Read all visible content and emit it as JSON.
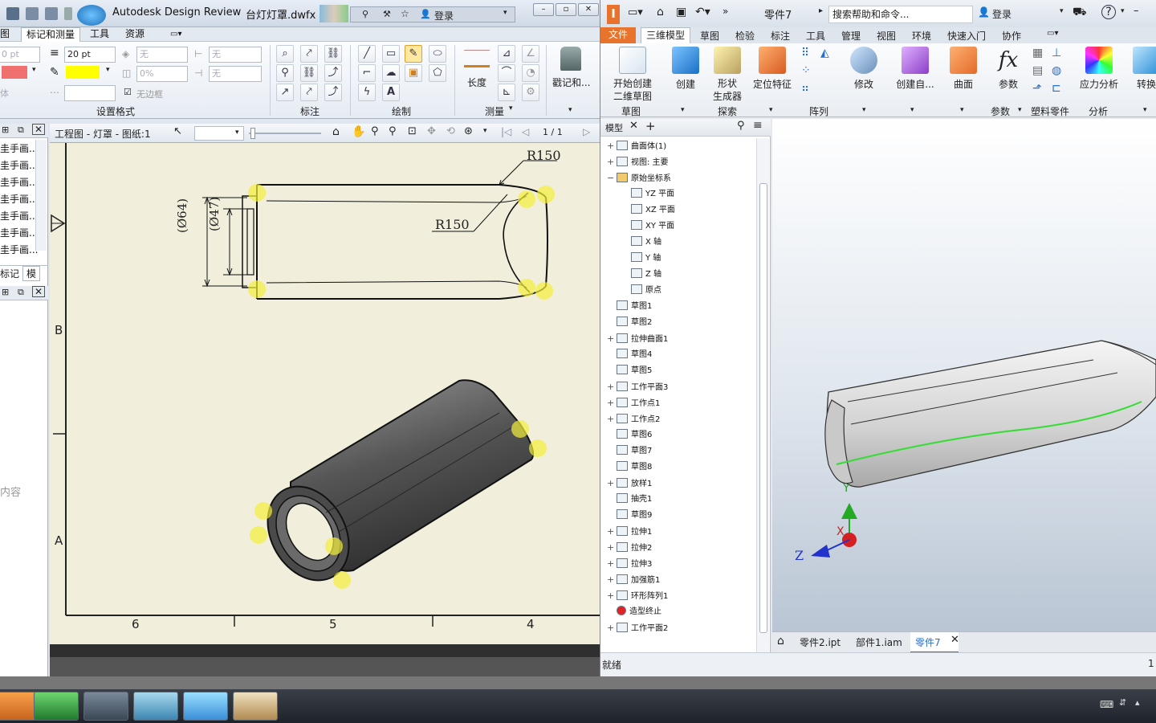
{
  "design_review": {
    "title": "Autodesk Design Review",
    "file": "台灯灯罩.dwfx",
    "signin": "登录",
    "tabs": [
      "图",
      "标记和测量",
      "工具",
      "资源"
    ],
    "format": {
      "line_width_small": "0 pt",
      "line_width": "20 pt",
      "fill_none": "无",
      "fill_none2": "无",
      "opacity": "0%",
      "none3": "无",
      "no_border": "无边框",
      "font_label": "体",
      "group_label": "设置格式",
      "line_color": "#f07070",
      "fill_color": "#ffff00"
    },
    "groups": {
      "annot": "标注",
      "draw": "绘制",
      "measure": "测量",
      "stamp": "戳记和..."
    },
    "measure_length": "长度",
    "panel_items": [
      "圭手画...",
      "圭手画...",
      "圭手画...",
      "圭手画...",
      "圭手画...",
      "圭手画...",
      "圭手画..."
    ],
    "panel_tabs": [
      "标记",
      "模"
    ],
    "panel_side_text": "内容",
    "view_title": "工程图 - 灯罩 - 图纸:1",
    "page_indicator": "1 / 1",
    "drawing": {
      "dim_r150_top": "R150",
      "dim_r150_inner": "R150",
      "dim_d64": "(Ø64)",
      "dim_d47": "(Ø47)",
      "zone_b": "B",
      "zone_a": "A",
      "col_6": "6",
      "col_5": "5",
      "col_4": "4"
    }
  },
  "inventor": {
    "part_name": "零件7",
    "search_placeholder": "搜索帮助和命令...",
    "signin": "登录",
    "tabs": [
      "文件",
      "三维模型",
      "草图",
      "检验",
      "标注",
      "工具",
      "管理",
      "视图",
      "环境",
      "快速入门",
      "协作"
    ],
    "ribbon": {
      "start_sketch": "开始创建\n二维草图",
      "create": "创建",
      "shape_gen": "形状\n生成器",
      "locate": "定位特征",
      "modify": "修改",
      "create_free": "创建自...",
      "surface": "曲面",
      "params": "参数",
      "stress": "应力分析",
      "convert": "转换",
      "grp_sketch": "草图",
      "grp_explore": "探索",
      "grp_pattern": "阵列",
      "grp_params": "参数",
      "grp_plastic": "塑料零件",
      "grp_analysis": "分析"
    },
    "browser_tab": "模型",
    "tree": [
      {
        "pm": "+",
        "label": "曲面体(1)"
      },
      {
        "pm": "+",
        "label": "视图: 主要"
      },
      {
        "pm": "−",
        "label": "原始坐标系"
      },
      {
        "pm": "",
        "label": "YZ 平面",
        "indent": true
      },
      {
        "pm": "",
        "label": "XZ 平面",
        "indent": true
      },
      {
        "pm": "",
        "label": "XY 平面",
        "indent": true
      },
      {
        "pm": "",
        "label": "X 轴",
        "indent": true
      },
      {
        "pm": "",
        "label": "Y 轴",
        "indent": true
      },
      {
        "pm": "",
        "label": "Z 轴",
        "indent": true
      },
      {
        "pm": "",
        "label": "原点",
        "indent": true
      },
      {
        "pm": "",
        "label": "草图1"
      },
      {
        "pm": "",
        "label": "草图2"
      },
      {
        "pm": "+",
        "label": "拉伸曲面1"
      },
      {
        "pm": "",
        "label": "草图4"
      },
      {
        "pm": "",
        "label": "草图5"
      },
      {
        "pm": "+",
        "label": "工作平面3"
      },
      {
        "pm": "+",
        "label": "工作点1"
      },
      {
        "pm": "+",
        "label": "工作点2"
      },
      {
        "pm": "",
        "label": "草图6"
      },
      {
        "pm": "",
        "label": "草图7"
      },
      {
        "pm": "",
        "label": "草图8"
      },
      {
        "pm": "+",
        "label": "放样1"
      },
      {
        "pm": "",
        "label": "抽壳1"
      },
      {
        "pm": "",
        "label": "草图9"
      },
      {
        "pm": "+",
        "label": "拉伸1"
      },
      {
        "pm": "+",
        "label": "拉伸2"
      },
      {
        "pm": "+",
        "label": "拉伸3"
      },
      {
        "pm": "+",
        "label": "加强筋1"
      },
      {
        "pm": "+",
        "label": "环形阵列1"
      },
      {
        "pm": "",
        "label": "造型终止"
      },
      {
        "pm": "+",
        "label": "工作平面2"
      }
    ],
    "doc_tabs": [
      "零件2.ipt",
      "部件1.iam",
      "零件7"
    ],
    "axis_y": "Y",
    "axis_x": "X",
    "axis_z": "Z",
    "status": "就绪",
    "status_right": "1"
  },
  "colors": {
    "highlight": "#f4f03a",
    "edge": "#33dd33",
    "inventor_orange": "#e8732c"
  }
}
